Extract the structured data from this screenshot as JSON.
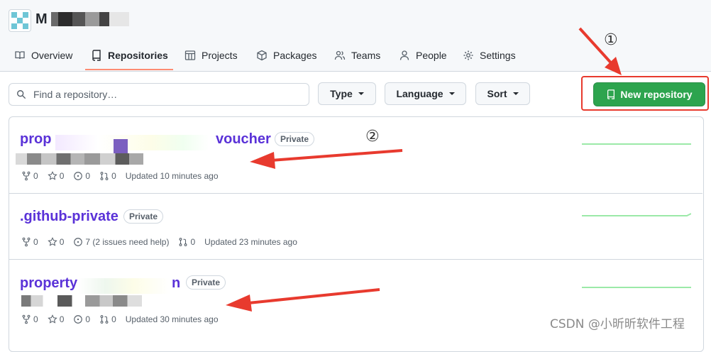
{
  "org": {
    "name_visible": "M",
    "avatar_color": "#6fc6d6"
  },
  "nav": {
    "items": [
      {
        "label": "Overview",
        "icon": "book-open-icon"
      },
      {
        "label": "Repositories",
        "icon": "repo-icon"
      },
      {
        "label": "Projects",
        "icon": "table-icon"
      },
      {
        "label": "Packages",
        "icon": "package-icon"
      },
      {
        "label": "Teams",
        "icon": "people-icon"
      },
      {
        "label": "People",
        "icon": "person-icon"
      },
      {
        "label": "Settings",
        "icon": "gear-icon"
      }
    ],
    "active": "Repositories",
    "underline_color": "#fd8c73"
  },
  "toolbar": {
    "search_placeholder": "Find a repository…",
    "type_label": "Type",
    "language_label": "Language",
    "sort_label": "Sort",
    "new_repo_label": "New repository",
    "new_repo_color": "#2da44e"
  },
  "annotations": {
    "marker1": "①",
    "marker2": "②",
    "color": "#e83a2e"
  },
  "repos": [
    {
      "title_prefix": "prop",
      "title_suffix": "voucher",
      "visibility": "Private",
      "forks": "0",
      "stars": "0",
      "issues": "0",
      "prs": "0",
      "updated": "Updated 10 minutes ago"
    },
    {
      "title": ".github-private",
      "visibility": "Private",
      "forks": "0",
      "stars": "0",
      "issues": "7 (2 issues need help)",
      "prs": "0",
      "updated": "Updated 23 minutes ago"
    },
    {
      "title_prefix": "property",
      "title_suffix": "n",
      "visibility": "Private",
      "forks": "0",
      "stars": "0",
      "issues": "0",
      "prs": "0",
      "updated": "Updated 30 minutes ago"
    }
  ],
  "watermark": "CSDN @小昕昕软件工程"
}
